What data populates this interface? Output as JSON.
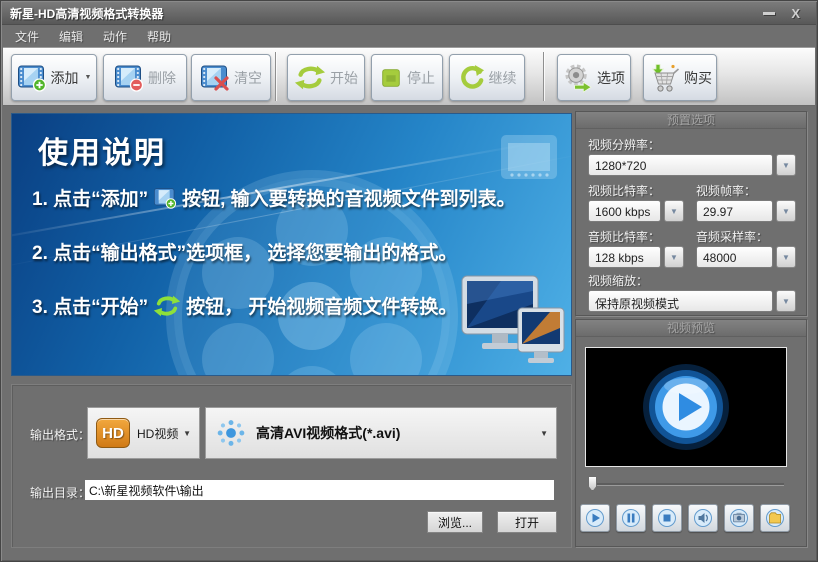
{
  "window": {
    "title": "新星-HD高清视频格式转换器",
    "close_glyph": "X"
  },
  "menu": {
    "items": [
      "文件",
      "编辑",
      "动作",
      "帮助"
    ]
  },
  "toolbar": {
    "add": "添加",
    "remove": "删除",
    "clear": "清空",
    "start": "开始",
    "stop": "停止",
    "resume": "继续",
    "options": "选项",
    "buy": "购买"
  },
  "icons": {
    "dropdown_arrow": "▼"
  },
  "instructions": {
    "title": "使用说明",
    "step1_pre": "1. 点击“添加”",
    "step1_post": "按钮, 输入要转换的音视频文件到列表。",
    "step2": "2. 点击“输出格式”选项框， 选择您要输出的格式。",
    "step3_pre": "3. 点击“开始”",
    "step3_post": "按钮， 开始视频音频文件转换。"
  },
  "preset": {
    "header": "预置选项",
    "resolution_label": "视频分辨率：",
    "resolution_value": "1280*720",
    "video_bitrate_label": "视频比特率：",
    "video_bitrate_value": "1600 kbps",
    "framerate_label": "视频帧率：",
    "framerate_value": "29.97",
    "audio_bitrate_label": "音频比特率：",
    "audio_bitrate_value": "128 kbps",
    "samplerate_label": "音频采样率：",
    "samplerate_value": "48000",
    "scale_label": "视频缩放：",
    "scale_value": "保持原视频模式"
  },
  "preview": {
    "header": "视频预览"
  },
  "output": {
    "format_label": "输出格式：",
    "hd_badge": "HD",
    "category_value": "HD视频",
    "format_value": "高清AVI视频格式(*.avi)",
    "dir_label": "输出目录：",
    "dir_value": "C:\\新星视频软件\\输出",
    "browse": "浏览...",
    "open": "打开"
  },
  "colors": {
    "accent_green": "#a5cc3d",
    "panel_blue_start": "#0a3f82",
    "panel_blue_end": "#4fb0e6",
    "hd_badge_orange": "#d07a16"
  }
}
